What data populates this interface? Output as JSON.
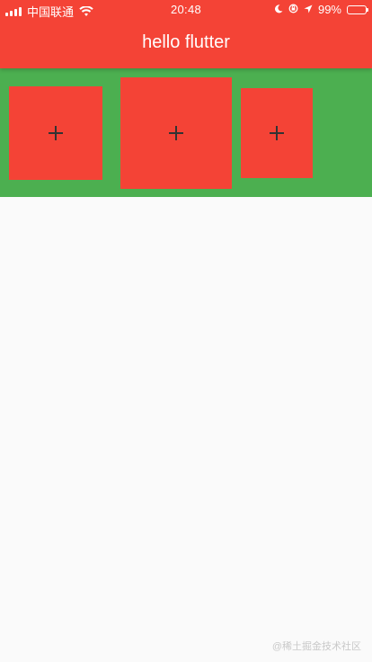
{
  "status_bar": {
    "carrier": "中国联通",
    "time": "20:48",
    "battery": "99%",
    "icons": [
      "signal-icon",
      "wifi-icon",
      "moon-icon",
      "orientation-lock-icon",
      "location-icon",
      "battery-icon"
    ]
  },
  "app_bar": {
    "title": "hello flutter",
    "color": "#F44336"
  },
  "row": {
    "background": "#4CAF50",
    "boxes": [
      {
        "label": "+"
      },
      {
        "label": "+"
      },
      {
        "label": "+"
      }
    ]
  },
  "watermark": "@稀土掘金技术社区"
}
